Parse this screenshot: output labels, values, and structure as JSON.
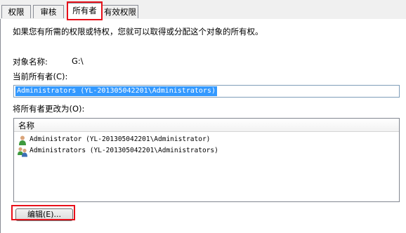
{
  "tabs": [
    {
      "label": "权限"
    },
    {
      "label": "审核"
    },
    {
      "label": "所有者"
    },
    {
      "label": "有效权限"
    }
  ],
  "description": "如果您有所需的权限或特权，您就可以取得或分配这个对象的所有权。",
  "object_name_label": "对象名称:",
  "object_name_value": "G:\\",
  "current_owner_label": "当前所有者(C):",
  "current_owner_value": "Administrators (YL-201305042201\\Administrators)",
  "change_owner_label": "将所有者更改为(O):",
  "list": {
    "header": "名称",
    "rows": [
      {
        "label": "Administrator (YL-201305042201\\Administrator)",
        "icon": "user-icon"
      },
      {
        "label": "Administrators (YL-201305042201\\Administrators)",
        "icon": "user-group-icon"
      }
    ]
  },
  "edit_button_label": "编辑(E)...",
  "colors": {
    "highlight": "#e8101a",
    "selection": "#3399ff"
  }
}
